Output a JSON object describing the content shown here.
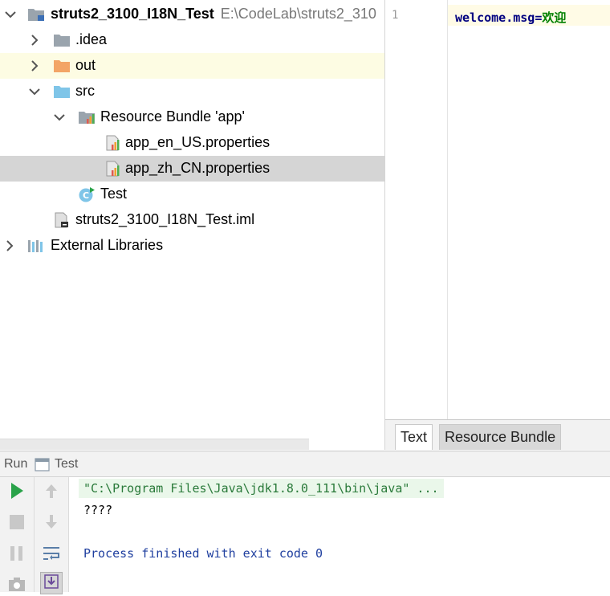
{
  "project": {
    "root_name": "struts2_3100_I18N_Test",
    "root_path": "E:\\CodeLab\\struts2_310",
    "items": [
      {
        "label": ".idea"
      },
      {
        "label": "out"
      },
      {
        "label": "src"
      },
      {
        "label": "Resource Bundle 'app'"
      },
      {
        "label": "app_en_US.properties"
      },
      {
        "label": "app_zh_CN.properties"
      },
      {
        "label": "Test"
      },
      {
        "label": "struts2_3100_I18N_Test.iml"
      },
      {
        "label": "External Libraries"
      }
    ]
  },
  "editor": {
    "line_number": "1",
    "code_key": "welcome.msg",
    "code_eq": "=",
    "code_value": "欢迎",
    "tabs": [
      "Text",
      "Resource Bundle"
    ]
  },
  "run": {
    "title": "Run",
    "config_name": "Test",
    "command": "\"C:\\Program Files\\Java\\jdk1.8.0_111\\bin\\java\" ...",
    "output": "????",
    "exit_message": "Process finished with exit code 0"
  },
  "colors": {
    "folder_gray": "#9aa4ad",
    "folder_orange": "#f3a566",
    "folder_blue": "#7fc5e8",
    "run_green": "#2aa34a",
    "selection": "#d5d5d5",
    "highlight": "#fdfce3"
  }
}
